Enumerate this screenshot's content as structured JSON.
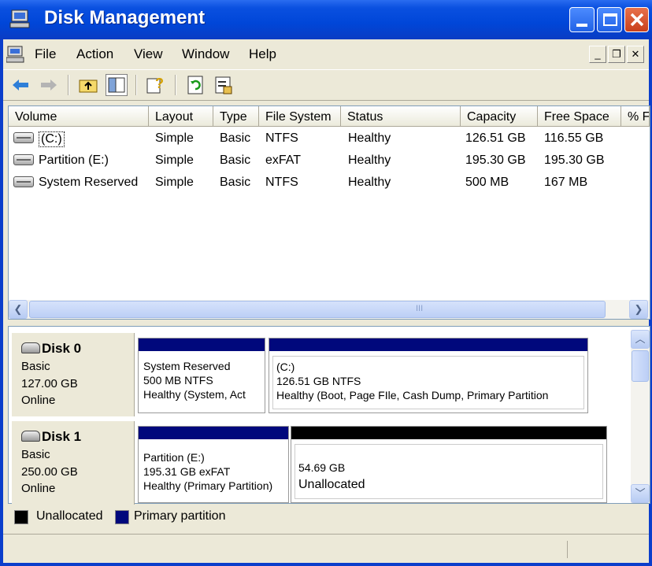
{
  "window": {
    "title": "Disk Management",
    "controls": [
      "minimize",
      "maximize",
      "close"
    ]
  },
  "menu": {
    "items": [
      {
        "label": "File"
      },
      {
        "label": "Action"
      },
      {
        "label": "View"
      },
      {
        "label": "Window"
      },
      {
        "label": "Help"
      }
    ]
  },
  "toolbar": {
    "buttons": [
      "back-arrow-icon",
      "forward-arrow-icon",
      "up-folder-icon",
      "show-hide-tree-icon",
      "help-icon",
      "refresh-icon",
      "properties-icon"
    ]
  },
  "volume_list": {
    "columns": [
      "Volume",
      "Layout",
      "Type",
      "File System",
      "Status",
      "Capacity",
      "Free Space",
      "% F"
    ],
    "rows": [
      {
        "volume": "(C:)",
        "layout": "Simple",
        "type": "Basic",
        "fs": "NTFS",
        "status": "Healthy",
        "capacity": "126.51 GB",
        "free": "116.55 GB"
      },
      {
        "volume": "Partition (E:)",
        "layout": "Simple",
        "type": "Basic",
        "fs": "exFAT",
        "status": "Healthy",
        "capacity": "195.30 GB",
        "free": "195.30 GB"
      },
      {
        "volume": "System Reserved",
        "layout": "Simple",
        "type": "Basic",
        "fs": "NTFS",
        "status": "Healthy",
        "capacity": "500 MB",
        "free": "167 MB"
      }
    ],
    "scroll_marker": "III"
  },
  "disks": [
    {
      "name": "Disk 0",
      "type": "Basic",
      "size": "127.00 GB",
      "state": "Online",
      "partitions": [
        {
          "l1": "System Reserved",
          "l2": "500 MB NTFS",
          "l3": "Healthy (System, Act",
          "color": "#00087c"
        },
        {
          "l1": "(C:)",
          "l2": "126.51 GB NTFS",
          "l3": "Healthy (Boot, Page FIle, Cash Dump, Primary Partition",
          "color": "#00087c"
        }
      ]
    },
    {
      "name": "Disk 1",
      "type": "Basic",
      "size": "250.00 GB",
      "state": "Online",
      "partitions": [
        {
          "l1": "Partition (E:)",
          "l2": "195.31 GB exFAT",
          "l3": "Healthy (Primary Partition)",
          "color": "#00087c"
        },
        {
          "l1": "",
          "l2": "54.69 GB",
          "l3": "Unallocated",
          "color": "#000000"
        }
      ]
    }
  ],
  "legend": {
    "unallocated": "Unallocated",
    "primary": "Primary partition",
    "unallocated_color": "#000000",
    "primary_color": "#00087c"
  }
}
